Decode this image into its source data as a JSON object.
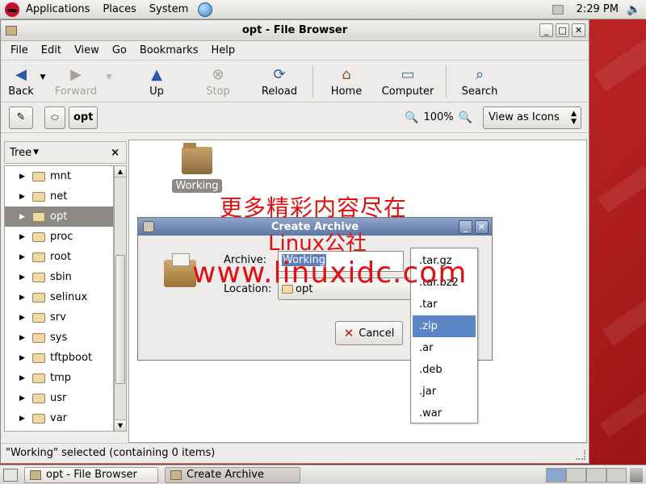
{
  "top_panel": {
    "menus": [
      "Applications",
      "Places",
      "System"
    ],
    "clock": "2:29 PM"
  },
  "window": {
    "title": "opt - File Browser",
    "controls": [
      "_",
      "□",
      "✕"
    ]
  },
  "menubar": [
    "File",
    "Edit",
    "View",
    "Go",
    "Bookmarks",
    "Help"
  ],
  "toolbar": {
    "back": "Back",
    "forward": "Forward",
    "up": "Up",
    "stop": "Stop",
    "reload": "Reload",
    "home": "Home",
    "computer": "Computer",
    "search": "Search"
  },
  "location": {
    "path_button": "opt",
    "zoom": "100%",
    "view_mode": "View as Icons"
  },
  "sidebar": {
    "header": "Tree",
    "close": "×",
    "items": [
      {
        "label": "mnt"
      },
      {
        "label": "net"
      },
      {
        "label": "opt",
        "selected": true
      },
      {
        "label": "proc"
      },
      {
        "label": "root"
      },
      {
        "label": "sbin"
      },
      {
        "label": "selinux"
      },
      {
        "label": "srv"
      },
      {
        "label": "sys"
      },
      {
        "label": "tftpboot"
      },
      {
        "label": "tmp"
      },
      {
        "label": "usr"
      },
      {
        "label": "var"
      }
    ]
  },
  "content": {
    "items": [
      {
        "label": "Working"
      }
    ]
  },
  "status": "\"Working\" selected (containing 0 items)",
  "dialog": {
    "title": "Create Archive",
    "archive_label": "Archive:",
    "archive_value": "Working",
    "location_label": "Location:",
    "location_value": "opt",
    "cancel": "Cancel"
  },
  "extensions": [
    ".tar.gz",
    ".tar.bz2",
    ".tar",
    ".zip",
    ".ar",
    ".deb",
    ".jar",
    ".war"
  ],
  "selected_extension": ".zip",
  "watermark": {
    "line1": "更多精彩内容尽在",
    "line2": "Linux公社",
    "url": "www.linuxidc.com"
  },
  "taskbar": {
    "tasks": [
      "opt - File Browser",
      "Create Archive"
    ]
  },
  "colors": {
    "selection": "#5a86c6",
    "watermark": "#e01010",
    "desktop": "#b01c1c"
  }
}
